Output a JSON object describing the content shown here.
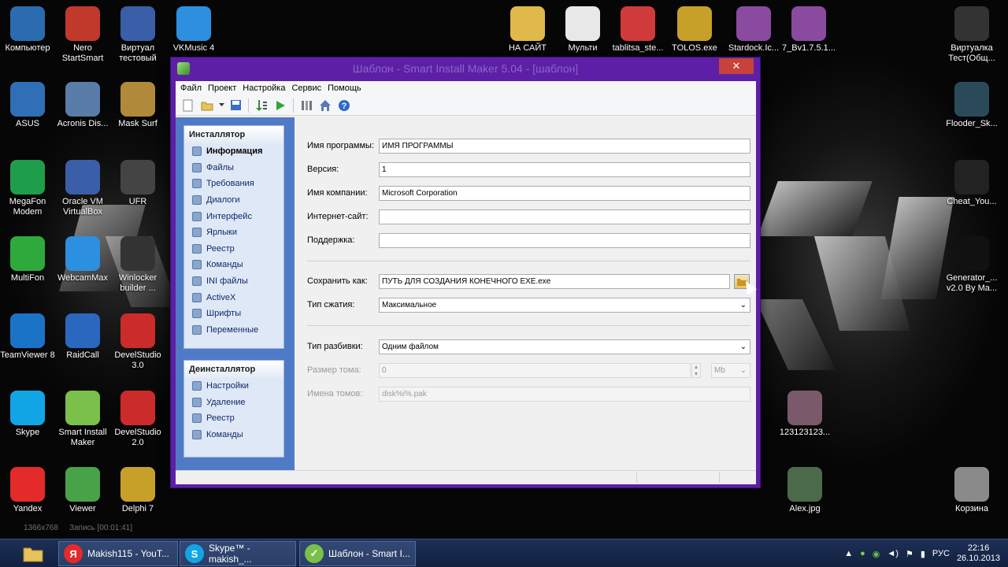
{
  "window": {
    "title": "Шаблон - Smart Install Maker 5.04 - [шаблон]",
    "close_label": "✕"
  },
  "menu": [
    "Файл",
    "Проект",
    "Настройка",
    "Сервис",
    "Помощь"
  ],
  "toolbar_icons": [
    "new-icon",
    "open-icon",
    "dropdown-arrow-icon",
    "save-icon",
    "build-icon",
    "run-icon",
    "settings-icon",
    "home-icon",
    "help-icon"
  ],
  "installer_group": {
    "title": "Инсталлятор",
    "items": [
      "Информация",
      "Файлы",
      "Требования",
      "Диалоги",
      "Интерфейс",
      "Ярлыки",
      "Реестр",
      "Команды",
      "INI файлы",
      "ActiveX",
      "Шрифты",
      "Переменные"
    ]
  },
  "uninstaller_group": {
    "title": "Деинсталлятор",
    "items": [
      "Настройки",
      "Удаление",
      "Реестр",
      "Команды"
    ]
  },
  "form": {
    "program_name_label": "Имя программы:",
    "program_name_value": "ИМЯ ПРОГРАММЫ",
    "version_label": "Версия:",
    "version_value": "1",
    "company_label": "Имя компании:",
    "company_value": "Microsoft Corporation",
    "website_label": "Интернет-сайт:",
    "website_value": "",
    "support_label": "Поддержка:",
    "support_value": "",
    "save_as_label": "Сохранить как:",
    "save_as_value": "ПУТЬ ДЛЯ СОЗДАНИЯ КОНЕЧНОГО EXE.exe",
    "compression_label": "Тип сжатия:",
    "compression_value": "Максимальное",
    "split_label": "Тип разбивки:",
    "split_value": "Одним файлом",
    "volume_size_label": "Размер тома:",
    "volume_size_value": "0",
    "volume_unit_value": "Mb",
    "volume_names_label": "Имена томов:",
    "volume_names_value": "disk%i%.pak"
  },
  "desktop_left": [
    {
      "label": "Компьютер",
      "icon": "computer-icon",
      "color": "#2b6cb0"
    },
    {
      "label": "Nero StartSmart",
      "icon": "nero-icon",
      "color": "#c0392b"
    },
    {
      "label": "Виртуал тестовый",
      "icon": "virtualbox-icon",
      "color": "#3b5ea8"
    },
    {
      "label": "VKMusic 4",
      "icon": "vkmusic-icon",
      "color": "#2d8fe0"
    },
    {
      "label": "ASUS",
      "icon": "asus-icon",
      "color": "#2f6fb5"
    },
    {
      "label": "Acronis Dis...",
      "icon": "acronis-icon",
      "color": "#5a7ca8"
    },
    {
      "label": "Mask Surf",
      "icon": "mask-icon",
      "color": "#b08a3a"
    },
    {
      "label": "MegaFon Modem",
      "icon": "megafon-icon",
      "color": "#1e9e4a"
    },
    {
      "label": "Oracle VM VirtualBox",
      "icon": "virtualbox-icon",
      "color": "#3b5ea8"
    },
    {
      "label": "UFR",
      "icon": "ufr-icon",
      "color": "#444444"
    },
    {
      "label": "MultiFon",
      "icon": "multifon-icon",
      "color": "#2eaa3c"
    },
    {
      "label": "WebcamMax",
      "icon": "webcam-icon",
      "color": "#2d8fe0"
    },
    {
      "label": "Winlocker builder ...",
      "icon": "winlocker-icon",
      "color": "#333333"
    },
    {
      "label": "TeamViewer 8",
      "icon": "teamviewer-icon",
      "color": "#1a73c6"
    },
    {
      "label": "RaidCall",
      "icon": "raidcall-icon",
      "color": "#2a68c0"
    },
    {
      "label": "DevelStudio 3.0",
      "icon": "soul-icon",
      "color": "#cc2b2b"
    },
    {
      "label": "Skype",
      "icon": "skype-icon",
      "color": "#12a5e6"
    },
    {
      "label": "Smart Install Maker",
      "icon": "smart-install-icon",
      "color": "#7ac04a"
    },
    {
      "label": "DevelStudio 2.0",
      "icon": "soul-icon",
      "color": "#cc2b2b"
    },
    {
      "label": "Yandex",
      "icon": "yandex-icon",
      "color": "#e52a2a"
    },
    {
      "label": "Viewer",
      "icon": "viewer-icon",
      "color": "#48a348"
    },
    {
      "label": "Delphi 7",
      "icon": "delphi-icon",
      "color": "#c7a02a"
    }
  ],
  "desktop_top": [
    {
      "label": "НА САЙТ",
      "icon": "folder-icon",
      "color": "#e0b94a"
    },
    {
      "label": "Мульти",
      "icon": "file-icon",
      "color": "#e8e8e8"
    },
    {
      "label": "tablitsa_ste...",
      "icon": "document-icon",
      "color": "#d03a3a"
    },
    {
      "label": "TOLOS.exe",
      "icon": "tolos-icon",
      "color": "#c7a02a"
    },
    {
      "label": "Stardock.Ic...",
      "icon": "archive-icon",
      "color": "#8a4aa0"
    },
    {
      "label": "7_Bv1.7.5.1...",
      "icon": "archive-icon",
      "color": "#8a4aa0"
    }
  ],
  "desktop_right": [
    {
      "label": "Виртуалка Тест(Общ...",
      "icon": "phone-icon",
      "color": "#333333"
    },
    {
      "label": "Flooder_Sk...",
      "icon": "flooder-icon",
      "color": "#2a4a5a"
    },
    {
      "label": "Cheat_You...",
      "icon": "cheat-icon",
      "color": "#222222"
    },
    {
      "label": "Generator_... v2.0 By Ma...",
      "icon": "usb-icon",
      "color": "#111111"
    },
    {
      "label": "123123123...",
      "icon": "image-icon",
      "color": "#7a5a6a"
    },
    {
      "label": "Alex.jpg",
      "icon": "image-icon",
      "color": "#4a6a4a"
    },
    {
      "label": "Корзина",
      "icon": "recycle-bin-icon",
      "color": "#8a8a8a"
    }
  ],
  "recorder": [
    "1366x768",
    "Запись [00:01:41]"
  ],
  "taskbar": {
    "buttons": [
      {
        "label": "Makish115 - YouT...",
        "icon": "yandex-icon",
        "color": "#e52a2a",
        "glyph": "Я"
      },
      {
        "label": "Skype™ - makish_...",
        "icon": "skype-icon",
        "color": "#12a5e6",
        "glyph": "S"
      },
      {
        "label": "Шаблон - Smart I...",
        "icon": "smart-install-icon",
        "color": "#7ac04a",
        "glyph": "✓"
      }
    ],
    "lang": "РУС",
    "time": "22:16",
    "date": "26.10.2013"
  }
}
